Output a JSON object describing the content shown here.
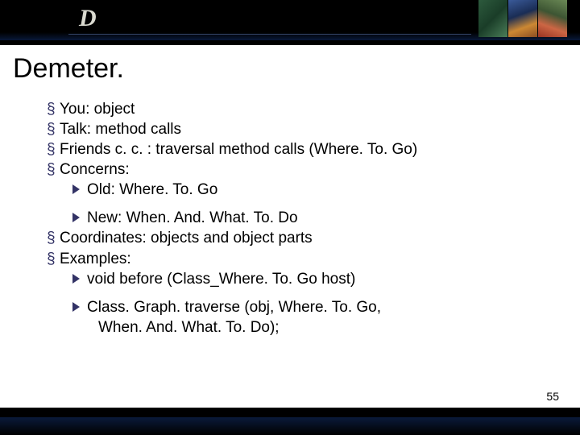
{
  "logo": "D",
  "title": "Demeter.",
  "bullets": {
    "b1": "You: object",
    "b2": "Talk: method calls",
    "b3": "Friends c. c. : traversal method calls (Where. To. Go)",
    "b4": "Concerns:",
    "b4a": "Old: Where. To. Go",
    "b4b": "New: When. And. What. To. Do",
    "b5": "Coordinates: objects and object parts",
    "b6": "Examples:",
    "b6a": "void before (Class_Where. To. Go host)",
    "b6b": "Class. Graph. traverse (obj, Where. To. Go,",
    "b6b_cont": "When. And. What. To. Do);"
  },
  "page_number": "55"
}
